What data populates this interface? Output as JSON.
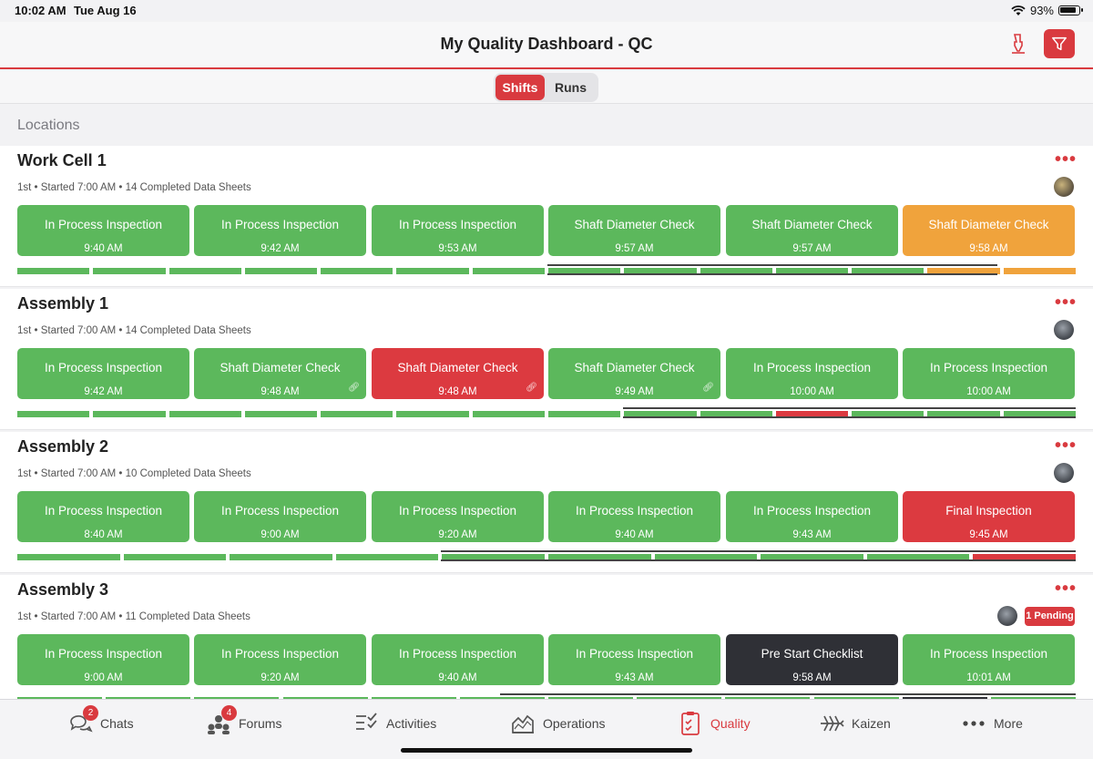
{
  "status": {
    "time": "10:02 AM",
    "date": "Tue Aug 16",
    "battery": "93%"
  },
  "header": {
    "title": "My Quality Dashboard - QC"
  },
  "segments": {
    "shifts": "Shifts",
    "runs": "Runs"
  },
  "locations_label": "Locations",
  "colors": {
    "green": "#5cb85c",
    "red": "#dc3a40",
    "orange": "#f0a33c",
    "dark": "#2f3036",
    "accent": "#d93a3f"
  },
  "sections": [
    {
      "name": "Work Cell 1",
      "meta": "1st • Started 7:00 AM • 14 Completed Data Sheets",
      "more": "•••",
      "cards": [
        {
          "title": "In Process Inspection",
          "time": "9:40 AM",
          "color": "green"
        },
        {
          "title": "In Process Inspection",
          "time": "9:42 AM",
          "color": "green"
        },
        {
          "title": "In Process Inspection",
          "time": "9:53 AM",
          "color": "green"
        },
        {
          "title": "Shaft Diameter Check",
          "time": "9:57 AM",
          "color": "green"
        },
        {
          "title": "Shaft Diameter Check",
          "time": "9:57 AM",
          "color": "green"
        },
        {
          "title": "Shaft Diameter Check",
          "time": "9:58 AM",
          "color": "orange"
        }
      ]
    },
    {
      "name": "Assembly 1",
      "meta": "1st • Started 7:00 AM • 14 Completed Data Sheets",
      "more": "•••",
      "cards": [
        {
          "title": "In Process Inspection",
          "time": "9:42 AM",
          "color": "green"
        },
        {
          "title": "Shaft Diameter Check",
          "time": "9:48 AM",
          "color": "green",
          "link": true
        },
        {
          "title": "Shaft Diameter Check",
          "time": "9:48 AM",
          "color": "red",
          "link": true
        },
        {
          "title": "Shaft Diameter Check",
          "time": "9:49 AM",
          "color": "green",
          "link": true
        },
        {
          "title": "In Process Inspection",
          "time": "10:00 AM",
          "color": "green"
        },
        {
          "title": "In Process Inspection",
          "time": "10:00 AM",
          "color": "green"
        }
      ]
    },
    {
      "name": "Assembly 2",
      "meta": "1st • Started 7:00 AM • 10 Completed Data Sheets",
      "more": "•••",
      "cards": [
        {
          "title": "In Process Inspection",
          "time": "8:40 AM",
          "color": "green"
        },
        {
          "title": "In Process Inspection",
          "time": "9:00 AM",
          "color": "green"
        },
        {
          "title": "In Process Inspection",
          "time": "9:20 AM",
          "color": "green"
        },
        {
          "title": "In Process Inspection",
          "time": "9:40 AM",
          "color": "green"
        },
        {
          "title": "In Process Inspection",
          "time": "9:43 AM",
          "color": "green"
        },
        {
          "title": "Final Inspection",
          "time": "9:45 AM",
          "color": "red"
        }
      ]
    },
    {
      "name": "Assembly 3",
      "meta": "1st • Started 7:00 AM • 11 Completed Data Sheets",
      "more": "•••",
      "pending": "1 Pending",
      "cards": [
        {
          "title": "In Process Inspection",
          "time": "9:00 AM",
          "color": "green"
        },
        {
          "title": "In Process Inspection",
          "time": "9:20 AM",
          "color": "green"
        },
        {
          "title": "In Process Inspection",
          "time": "9:40 AM",
          "color": "green"
        },
        {
          "title": "In Process Inspection",
          "time": "9:43 AM",
          "color": "green"
        },
        {
          "title": "Pre Start Checklist",
          "time": "9:58 AM",
          "color": "dark"
        },
        {
          "title": "In Process Inspection",
          "time": "10:01 AM",
          "color": "green"
        }
      ]
    }
  ],
  "timelines": [
    [
      "green",
      "green",
      "green",
      "green",
      "green",
      "green",
      "green",
      "green",
      "green",
      "green",
      "green",
      "green",
      "orange",
      "orange"
    ],
    [
      "green",
      "green",
      "green",
      "green",
      "green",
      "green",
      "green",
      "green",
      "green",
      "green",
      "red",
      "green",
      "green",
      "green"
    ],
    [
      "green",
      "green",
      "green",
      "green",
      "green",
      "green",
      "green",
      "green",
      "green",
      "red"
    ],
    [
      "green",
      "green",
      "green",
      "green",
      "green",
      "green",
      "green",
      "green",
      "green",
      "green",
      "dark",
      "green"
    ]
  ],
  "tabs": [
    {
      "label": "Chats",
      "badge": "2",
      "icon": "chat-bubbles-icon"
    },
    {
      "label": "Forums",
      "badge": "4",
      "icon": "people-network-icon"
    },
    {
      "label": "Activities",
      "icon": "checklist-icon"
    },
    {
      "label": "Operations",
      "icon": "area-chart-icon"
    },
    {
      "label": "Quality",
      "icon": "quality-clipboard-icon",
      "active": true
    },
    {
      "label": "Kaizen",
      "icon": "fishbone-icon"
    },
    {
      "label": "More",
      "icon": "more-dots-icon"
    }
  ]
}
